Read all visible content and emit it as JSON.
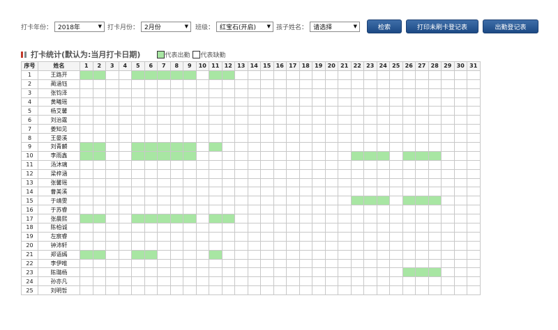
{
  "filters": {
    "year_label": "打卡年份：",
    "year_value": "2018年",
    "month_label": "打卡月份：",
    "month_value": "2月份",
    "class_label": "班级：",
    "class_value": "红宝石(开启)",
    "child_label": "孩子姓名：",
    "child_value": "请选择"
  },
  "buttons": {
    "search": "检索",
    "print": "打印未刷卡登记表",
    "attendance": "出勤登记表"
  },
  "section": {
    "title": "打卡统计(默认为:当月打卡日期)",
    "legend_present": "代表出勤",
    "legend_absent": "代表缺勤"
  },
  "colors": {
    "present": "#a8e6a3",
    "button": "#1c4a85"
  },
  "table": {
    "headers": [
      "序号",
      "姓名"
    ],
    "days": [
      "1",
      "2",
      "3",
      "4",
      "5",
      "6",
      "7",
      "8",
      "9",
      "10",
      "11",
      "12",
      "13",
      "14",
      "15",
      "16",
      "17",
      "18",
      "19",
      "20",
      "21",
      "22",
      "23",
      "24",
      "25",
      "26",
      "27",
      "28",
      "29",
      "30",
      "31"
    ],
    "rows": [
      {
        "no": "1",
        "name": "王路开",
        "present": [
          1,
          2,
          5,
          6,
          7,
          8,
          9,
          11,
          12
        ]
      },
      {
        "no": "2",
        "name": "蔺涵钰",
        "present": []
      },
      {
        "no": "3",
        "name": "张钧泽",
        "present": []
      },
      {
        "no": "4",
        "name": "黄曦瑶",
        "present": []
      },
      {
        "no": "5",
        "name": "杨艾馨",
        "present": []
      },
      {
        "no": "6",
        "name": "刘治霆",
        "present": []
      },
      {
        "no": "7",
        "name": "姜知见",
        "present": []
      },
      {
        "no": "8",
        "name": "王晏溪",
        "present": []
      },
      {
        "no": "9",
        "name": "刘青麟",
        "present": [
          1,
          2,
          5,
          6,
          7,
          8,
          9,
          11
        ]
      },
      {
        "no": "10",
        "name": "李雨鑫",
        "present": [
          1,
          2,
          5,
          6,
          7,
          8,
          9,
          22,
          23,
          24,
          26,
          27,
          28
        ]
      },
      {
        "no": "11",
        "name": "汤沐璃",
        "present": []
      },
      {
        "no": "12",
        "name": "梁梓涵",
        "present": []
      },
      {
        "no": "13",
        "name": "张馨瑶",
        "present": []
      },
      {
        "no": "14",
        "name": "曹美溪",
        "present": []
      },
      {
        "no": "15",
        "name": "于靖雯",
        "present": [
          22,
          23,
          24,
          26,
          27,
          28
        ]
      },
      {
        "no": "16",
        "name": "于苏睿",
        "present": []
      },
      {
        "no": "17",
        "name": "张晨熙",
        "present": [
          1,
          2,
          5,
          6,
          7,
          8,
          9,
          11,
          12
        ]
      },
      {
        "no": "18",
        "name": "陈柏诚",
        "present": []
      },
      {
        "no": "19",
        "name": "左宸睿",
        "present": []
      },
      {
        "no": "20",
        "name": "钟沛轩",
        "present": []
      },
      {
        "no": "21",
        "name": "郑语嫣",
        "present": [
          1,
          2,
          5,
          6,
          11
        ]
      },
      {
        "no": "22",
        "name": "李伊唯",
        "present": []
      },
      {
        "no": "23",
        "name": "陈璐杨",
        "present": [
          26,
          27,
          28
        ]
      },
      {
        "no": "24",
        "name": "孙亦凡",
        "present": []
      },
      {
        "no": "25",
        "name": "刘明哲",
        "present": []
      }
    ]
  }
}
